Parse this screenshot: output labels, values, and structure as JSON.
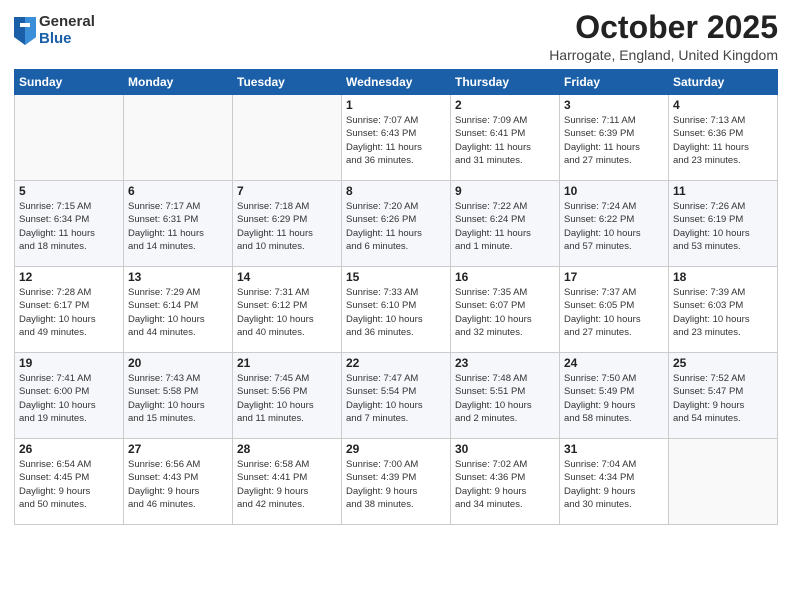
{
  "logo": {
    "general": "General",
    "blue": "Blue"
  },
  "header": {
    "month": "October 2025",
    "location": "Harrogate, England, United Kingdom"
  },
  "days_of_week": [
    "Sunday",
    "Monday",
    "Tuesday",
    "Wednesday",
    "Thursday",
    "Friday",
    "Saturday"
  ],
  "weeks": [
    [
      {
        "day": "",
        "info": ""
      },
      {
        "day": "",
        "info": ""
      },
      {
        "day": "",
        "info": ""
      },
      {
        "day": "1",
        "info": "Sunrise: 7:07 AM\nSunset: 6:43 PM\nDaylight: 11 hours\nand 36 minutes."
      },
      {
        "day": "2",
        "info": "Sunrise: 7:09 AM\nSunset: 6:41 PM\nDaylight: 11 hours\nand 31 minutes."
      },
      {
        "day": "3",
        "info": "Sunrise: 7:11 AM\nSunset: 6:39 PM\nDaylight: 11 hours\nand 27 minutes."
      },
      {
        "day": "4",
        "info": "Sunrise: 7:13 AM\nSunset: 6:36 PM\nDaylight: 11 hours\nand 23 minutes."
      }
    ],
    [
      {
        "day": "5",
        "info": "Sunrise: 7:15 AM\nSunset: 6:34 PM\nDaylight: 11 hours\nand 18 minutes."
      },
      {
        "day": "6",
        "info": "Sunrise: 7:17 AM\nSunset: 6:31 PM\nDaylight: 11 hours\nand 14 minutes."
      },
      {
        "day": "7",
        "info": "Sunrise: 7:18 AM\nSunset: 6:29 PM\nDaylight: 11 hours\nand 10 minutes."
      },
      {
        "day": "8",
        "info": "Sunrise: 7:20 AM\nSunset: 6:26 PM\nDaylight: 11 hours\nand 6 minutes."
      },
      {
        "day": "9",
        "info": "Sunrise: 7:22 AM\nSunset: 6:24 PM\nDaylight: 11 hours\nand 1 minute."
      },
      {
        "day": "10",
        "info": "Sunrise: 7:24 AM\nSunset: 6:22 PM\nDaylight: 10 hours\nand 57 minutes."
      },
      {
        "day": "11",
        "info": "Sunrise: 7:26 AM\nSunset: 6:19 PM\nDaylight: 10 hours\nand 53 minutes."
      }
    ],
    [
      {
        "day": "12",
        "info": "Sunrise: 7:28 AM\nSunset: 6:17 PM\nDaylight: 10 hours\nand 49 minutes."
      },
      {
        "day": "13",
        "info": "Sunrise: 7:29 AM\nSunset: 6:14 PM\nDaylight: 10 hours\nand 44 minutes."
      },
      {
        "day": "14",
        "info": "Sunrise: 7:31 AM\nSunset: 6:12 PM\nDaylight: 10 hours\nand 40 minutes."
      },
      {
        "day": "15",
        "info": "Sunrise: 7:33 AM\nSunset: 6:10 PM\nDaylight: 10 hours\nand 36 minutes."
      },
      {
        "day": "16",
        "info": "Sunrise: 7:35 AM\nSunset: 6:07 PM\nDaylight: 10 hours\nand 32 minutes."
      },
      {
        "day": "17",
        "info": "Sunrise: 7:37 AM\nSunset: 6:05 PM\nDaylight: 10 hours\nand 27 minutes."
      },
      {
        "day": "18",
        "info": "Sunrise: 7:39 AM\nSunset: 6:03 PM\nDaylight: 10 hours\nand 23 minutes."
      }
    ],
    [
      {
        "day": "19",
        "info": "Sunrise: 7:41 AM\nSunset: 6:00 PM\nDaylight: 10 hours\nand 19 minutes."
      },
      {
        "day": "20",
        "info": "Sunrise: 7:43 AM\nSunset: 5:58 PM\nDaylight: 10 hours\nand 15 minutes."
      },
      {
        "day": "21",
        "info": "Sunrise: 7:45 AM\nSunset: 5:56 PM\nDaylight: 10 hours\nand 11 minutes."
      },
      {
        "day": "22",
        "info": "Sunrise: 7:47 AM\nSunset: 5:54 PM\nDaylight: 10 hours\nand 7 minutes."
      },
      {
        "day": "23",
        "info": "Sunrise: 7:48 AM\nSunset: 5:51 PM\nDaylight: 10 hours\nand 2 minutes."
      },
      {
        "day": "24",
        "info": "Sunrise: 7:50 AM\nSunset: 5:49 PM\nDaylight: 9 hours\nand 58 minutes."
      },
      {
        "day": "25",
        "info": "Sunrise: 7:52 AM\nSunset: 5:47 PM\nDaylight: 9 hours\nand 54 minutes."
      }
    ],
    [
      {
        "day": "26",
        "info": "Sunrise: 6:54 AM\nSunset: 4:45 PM\nDaylight: 9 hours\nand 50 minutes."
      },
      {
        "day": "27",
        "info": "Sunrise: 6:56 AM\nSunset: 4:43 PM\nDaylight: 9 hours\nand 46 minutes."
      },
      {
        "day": "28",
        "info": "Sunrise: 6:58 AM\nSunset: 4:41 PM\nDaylight: 9 hours\nand 42 minutes."
      },
      {
        "day": "29",
        "info": "Sunrise: 7:00 AM\nSunset: 4:39 PM\nDaylight: 9 hours\nand 38 minutes."
      },
      {
        "day": "30",
        "info": "Sunrise: 7:02 AM\nSunset: 4:36 PM\nDaylight: 9 hours\nand 34 minutes."
      },
      {
        "day": "31",
        "info": "Sunrise: 7:04 AM\nSunset: 4:34 PM\nDaylight: 9 hours\nand 30 minutes."
      },
      {
        "day": "",
        "info": ""
      }
    ]
  ]
}
